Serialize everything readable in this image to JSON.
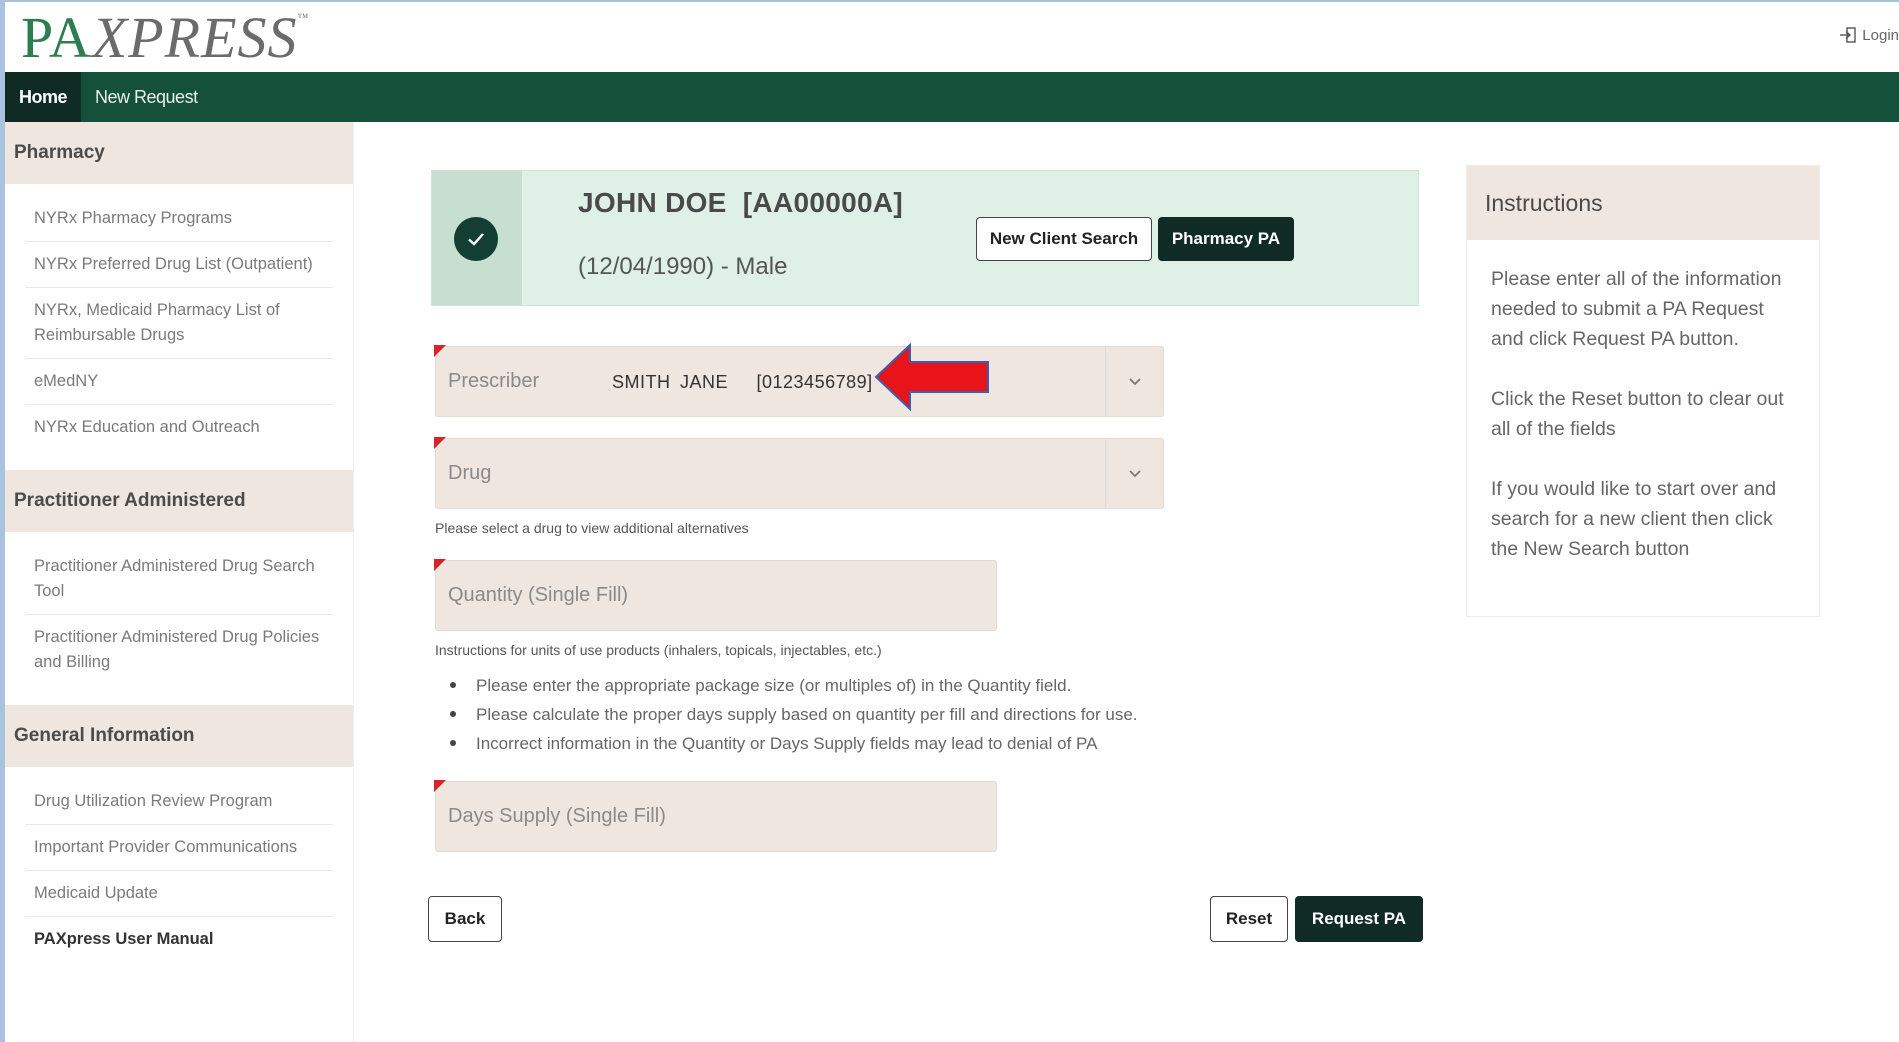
{
  "header": {
    "logo_prefix": "PA",
    "logo_rest": "XPRESS",
    "logo_tm": "™",
    "login_label": "Login"
  },
  "nav": {
    "items": [
      {
        "label": "Home"
      },
      {
        "label": "New Request"
      }
    ]
  },
  "sidebar": {
    "sections": [
      {
        "title": "Pharmacy",
        "items": [
          {
            "label": "NYRx Pharmacy Programs"
          },
          {
            "label": "NYRx Preferred Drug List (Outpatient)"
          },
          {
            "label": "NYRx, Medicaid Pharmacy List of Reimbursable Drugs"
          },
          {
            "label": "eMedNY"
          },
          {
            "label": "NYRx Education and Outreach"
          }
        ]
      },
      {
        "title": "Practitioner Administered",
        "items": [
          {
            "label": "Practitioner Administered Drug Search Tool"
          },
          {
            "label": "Practitioner Administered Drug Policies and Billing"
          }
        ]
      },
      {
        "title": "General Information",
        "items": [
          {
            "label": "Drug Utilization Review Program"
          },
          {
            "label": "Important Provider Communications"
          },
          {
            "label": "Medicaid Update"
          },
          {
            "label": "PAXpress User Manual"
          }
        ]
      }
    ]
  },
  "client": {
    "name": "JOHN DOE  [AA00000A]",
    "dob_gender": "(12/04/1990) - Male",
    "new_client_search_label": "New Client Search",
    "pharmacy_pa_label": "Pharmacy PA"
  },
  "form": {
    "prescriber_label": "Prescriber",
    "prescriber_value": "SMITH JANE   [0123456789]",
    "drug_label": "Drug",
    "drug_help": "Please select a drug to view additional alternatives",
    "quantity_label": "Quantity (Single Fill)",
    "units_help": "Instructions for units of use products (inhalers, topicals, injectables, etc.)",
    "bullets": [
      "Please enter the appropriate package size (or multiples of) in the Quantity field.",
      "Please calculate the proper days supply based on quantity per fill and directions for use.",
      "Incorrect information in the Quantity or Days Supply fields may lead to denial of PA"
    ],
    "days_supply_label": "Days Supply (Single Fill)",
    "back_label": "Back",
    "reset_label": "Reset",
    "request_pa_label": "Request PA"
  },
  "instructions": {
    "title": "Instructions",
    "paragraphs": [
      "Please enter all of the information needed to submit a PA Request and click Request PA button.",
      "Click the Reset button to clear out all of the fields",
      "If you would like to start over and search for a new client then click the New Search button"
    ]
  },
  "colors": {
    "nav_bg": "#14503a",
    "nav_active_bg": "#0f2b24",
    "section_bg": "#efe6df",
    "client_card_bg": "#dff0e6",
    "required_mark": "#d6242a",
    "annotation_arrow": "#e8141a"
  }
}
